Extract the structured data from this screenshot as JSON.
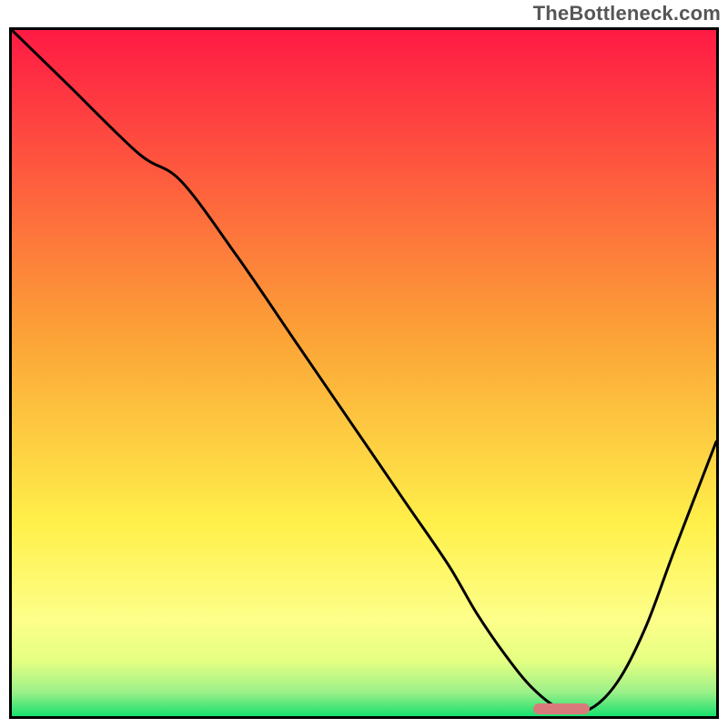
{
  "watermark": "TheBottleneck.com",
  "chart_data": {
    "type": "line",
    "title": "",
    "xlabel": "",
    "ylabel": "",
    "xlim": [
      0,
      100
    ],
    "ylim": [
      0,
      100
    ],
    "grid": false,
    "legend": false,
    "background_gradient": {
      "stops": [
        {
          "offset": 0.0,
          "color": "#ff1a44"
        },
        {
          "offset": 0.45,
          "color": "#fca437"
        },
        {
          "offset": 0.72,
          "color": "#fff04a"
        },
        {
          "offset": 0.86,
          "color": "#fdff8a"
        },
        {
          "offset": 0.92,
          "color": "#e4ff82"
        },
        {
          "offset": 0.965,
          "color": "#9cf089"
        },
        {
          "offset": 1.0,
          "color": "#19e06e"
        }
      ]
    },
    "series": [
      {
        "name": "curve",
        "x": [
          0,
          8,
          18,
          24,
          32,
          40,
          48,
          56,
          62,
          66,
          70,
          74,
          78,
          82,
          86,
          90,
          94,
          100
        ],
        "y": [
          100,
          92,
          82,
          78,
          67,
          55,
          43,
          31,
          22,
          15,
          9,
          4,
          1,
          1,
          5,
          13,
          24,
          40
        ]
      }
    ],
    "marker": {
      "x_start": 74,
      "x_end": 82,
      "y": 1,
      "color": "#d87a7c"
    }
  }
}
